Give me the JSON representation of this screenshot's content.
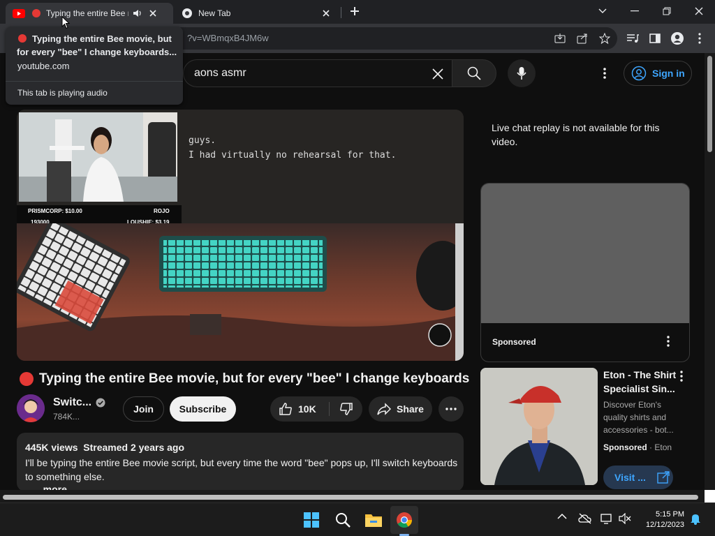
{
  "browser": {
    "tabs": [
      {
        "title": "Typing the entire Bee mo",
        "active": true,
        "audio": true
      },
      {
        "title": "New Tab",
        "active": false
      }
    ],
    "url": "?v=WBmqxB4JM6w",
    "tooltip": {
      "title": "Typing the entire Bee movie, but for every \"bee\" I change keyboards...",
      "domain": "youtube.com",
      "audio_note": "This tab is playing audio"
    }
  },
  "masthead": {
    "search_value": "aons asmr",
    "sign_in_label": "Sign in"
  },
  "video": {
    "editor_lines": [
      "guys.",
      "I had virtually no rehearsal for that."
    ],
    "donations": {
      "left_top": "PRISMCORP: $10.00",
      "right_top": "ROJO",
      "left_bottom": "193000",
      "right_bottom": "LOUSHIE: $3.19"
    },
    "title": "Typing the entire Bee movie, but for every \"bee\" I change keyboards",
    "channel_name": "Switc...",
    "subscriber_count": "784K...",
    "join_label": "Join",
    "subscribe_label": "Subscribe",
    "likes": "10K",
    "share_label": "Share",
    "description": {
      "meta": "445K views  Streamed 2 years ago",
      "text": "I'll be typing the entire Bee movie script, but every time the word \"bee\" pops up, I'll switch keyboards to something else.",
      "more": "...more"
    }
  },
  "sidebar": {
    "chat_note": "Live chat replay is not available for this video.",
    "ad1": {
      "sponsored_label": "Sponsored"
    },
    "ad2": {
      "title": "Eton - The Shirt Specialist Sin...",
      "description": "Discover Eton's quality shirts and accessories - bot...",
      "sponsored_label": "Sponsored",
      "advertiser": "Eton",
      "visit_label": "Visit ..."
    }
  },
  "taskbar": {
    "time": "5:15 PM",
    "date": "12/12/2023"
  },
  "colors": {
    "accent_red": "#e53935",
    "link_blue": "#3ea6ff"
  }
}
